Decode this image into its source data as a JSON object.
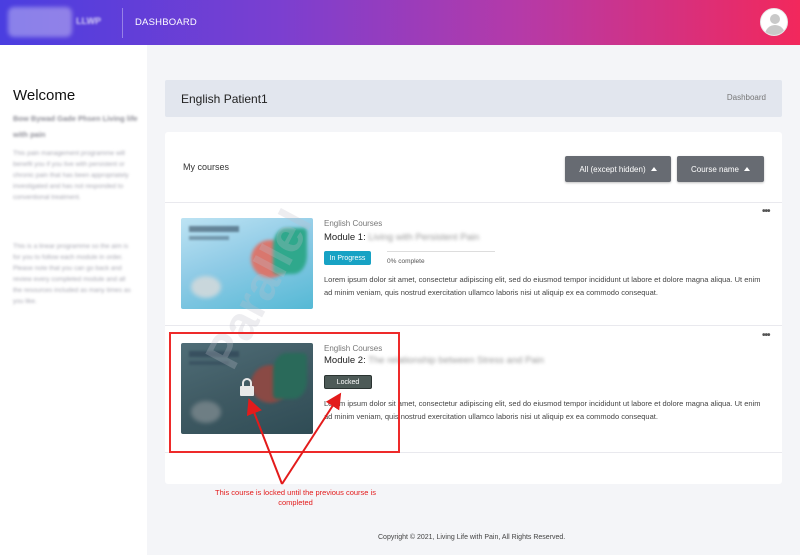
{
  "navbar": {
    "logo_text": "LLWP",
    "dashboard_label": "DASHBOARD"
  },
  "sidebar": {
    "welcome": "Welcome",
    "subtitle": "Bow Bywad Gade Phsen Living life with pain",
    "para1": "This pain management programme will benefit you if you live with persistent or chronic pain that has been appropriately investigated and has not responded to conventional treatment.",
    "para2": "This is a linear programme so the aim is for you to follow each module in order. Please note that you can go back and review every completed module and all the resources included as many times as you like."
  },
  "header": {
    "title": "English Patient1",
    "breadcrumb": "Dashboard"
  },
  "courses_section": {
    "heading": "My courses",
    "filter_label": "All (except hidden)",
    "sort_label": "Course name"
  },
  "courses": [
    {
      "category": "English Courses",
      "title_prefix": "Module 1:",
      "title_name": "Living with Persistent Pain",
      "status": "In Progress",
      "progress_percent": 0,
      "progress_text": "0% complete",
      "description": "Lorem ipsum dolor sit amet, consectetur adipiscing elit, sed do eiusmod tempor incididunt ut labore et dolore magna aliqua. Ut enim ad minim veniam, quis nostrud exercitation ullamco laboris nisi ut aliquip ex ea commodo consequat."
    },
    {
      "category": "English Courses",
      "title_prefix": "Module 2:",
      "title_name": "The relationship between Stress and Pain",
      "status": "Locked",
      "description": "Lorem ipsum dolor sit amet, consectetur adipiscing elit, sed do eiusmod tempor incididunt ut labore et dolore magna aliqua. Ut enim ad minim veniam, quis nostrud exercitation ullamco laboris nisi ut aliquip ex ea commodo consequat."
    }
  ],
  "annotation": {
    "text": "This course is locked until the previous course is completed",
    "color": "#e31b1b"
  },
  "watermark": "Parallel",
  "footer": "Copyright © 2021, Living Life with Pain, All Rights Reserved.",
  "colors": {
    "badge_in_progress": "#17a2c4",
    "badge_locked": "#4d5a57",
    "button_bg": "#676b72"
  }
}
